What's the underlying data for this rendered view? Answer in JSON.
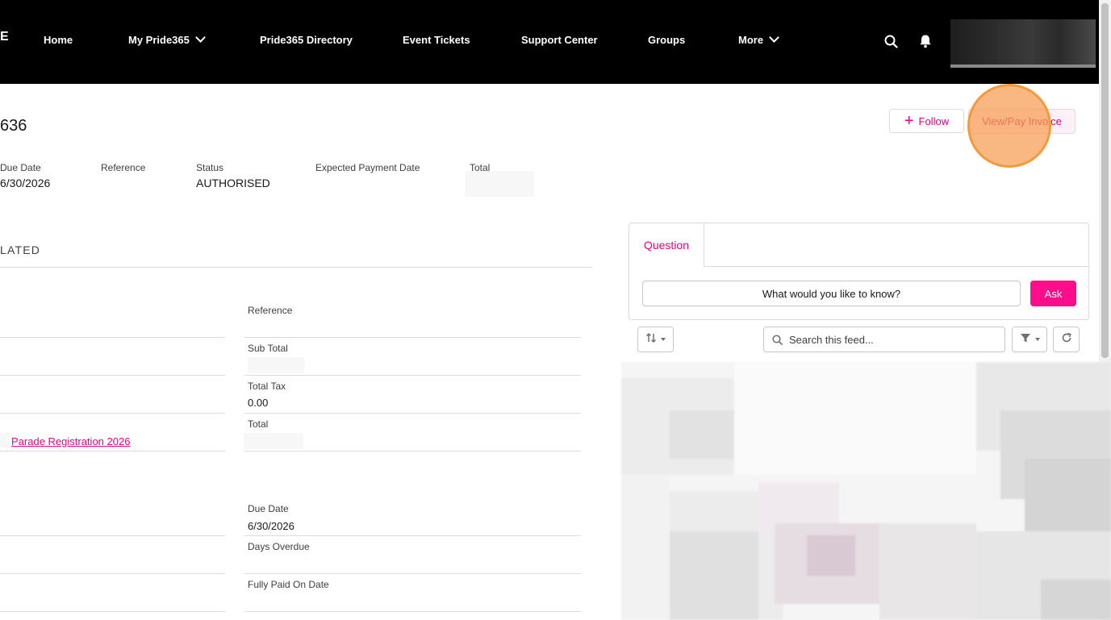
{
  "nav": {
    "logo_fragment": "E",
    "items": [
      {
        "label": "Home"
      },
      {
        "label": "My Pride365"
      },
      {
        "label": "Pride365 Directory"
      },
      {
        "label": "Event Tickets"
      },
      {
        "label": "Support Center"
      },
      {
        "label": "Groups"
      },
      {
        "label": "More"
      }
    ],
    "icons": [
      "search-icon",
      "bell-icon"
    ]
  },
  "record": {
    "title_fragment": "636",
    "fields": [
      {
        "label": "Due Date",
        "value": "6/30/2026"
      },
      {
        "label": "Reference",
        "value": ""
      },
      {
        "label": "Status",
        "value": "AUTHORISED"
      },
      {
        "label": "Expected Payment Date",
        "value": ""
      },
      {
        "label": "Total",
        "value": ""
      }
    ],
    "follow_label": "Follow",
    "viewpay_label": "View/Pay Invoice"
  },
  "details": {
    "section_tab": "LATED",
    "right_fields": [
      {
        "label": "Reference",
        "value": ""
      },
      {
        "label": "Sub Total",
        "value": ""
      },
      {
        "label": "Total Tax",
        "value": "0.00"
      },
      {
        "label": "Total",
        "value": ""
      },
      {
        "label": "Due Date",
        "value": "6/30/2026"
      },
      {
        "label": "Days Overdue",
        "value": ""
      },
      {
        "label": "Fully Paid On Date",
        "value": ""
      }
    ],
    "left_link": "Parade Registration 2026"
  },
  "publisher": {
    "tab_label": "Question",
    "input_placeholder": "What would you like to know?",
    "ask_label": "Ask"
  },
  "feed": {
    "search_placeholder": "Search this feed...",
    "icons": [
      "sort-icon",
      "filter-icon",
      "refresh-icon"
    ]
  },
  "colors": {
    "brand": "#e6007e",
    "ask_button": "#ff0d8a",
    "nav_bg": "#000000",
    "click_highlight": "#f39a3e"
  }
}
